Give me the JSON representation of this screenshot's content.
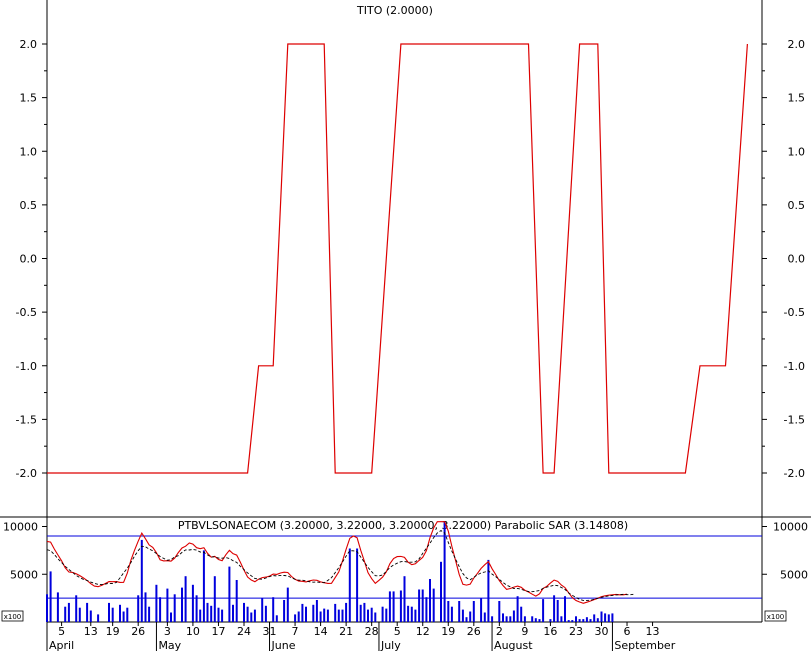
{
  "colors": {
    "tito": "#dd0000",
    "bars": "#0000dd",
    "band": "#0000dd",
    "sar": "#000000",
    "axis": "#000000"
  },
  "chart_data": [
    {
      "type": "line",
      "title": "TITO (2.0000)",
      "ylim": [
        -2.4,
        2.4
      ],
      "yticks": [
        "2.0",
        "1.5",
        "1.0",
        "0.5",
        "0.0",
        "-0.5",
        "-1.0",
        "-1.5",
        "-2.0"
      ],
      "ytick_values": [
        2.0,
        1.5,
        1.0,
        0.5,
        0.0,
        -0.5,
        -1.0,
        -1.5,
        -2.0
      ],
      "grid": false,
      "series": [
        {
          "values_x": [
            1,
            56,
            59,
            63,
            67,
            69,
            77,
            80,
            86,
            88,
            90,
            98,
            133,
            137,
            140,
            147,
            152,
            155,
            176,
            180,
            187,
            193
          ],
          "values_y": [
            -2,
            -2,
            -1,
            -1,
            2,
            2,
            2,
            -2,
            -2,
            -2,
            -2,
            2,
            2,
            -2,
            -2,
            2,
            2,
            -2,
            -2,
            -1,
            -1,
            2
          ]
        }
      ]
    },
    {
      "type": "bar",
      "title": "PTBVLSONAECOM (3.20000, 3.22000, 3.20000, 3.22000) Parabolic SAR (3.14808)",
      "ylim": [
        0,
        11000
      ],
      "yticks": [
        "10000",
        "5000"
      ],
      "ytick_values": [
        10000,
        5000
      ],
      "unit_label": "x100",
      "bands": [
        9000,
        2500
      ],
      "x_tick_labels": [
        "5",
        "13",
        "19",
        "26",
        "3",
        "10",
        "17",
        "24",
        "31",
        "7",
        "14",
        "21",
        "28",
        "5",
        "12",
        "19",
        "26",
        "2",
        "9",
        "16",
        "23",
        "30",
        "6",
        "13"
      ],
      "x_tick_days": [
        5,
        13,
        19,
        26,
        34,
        41,
        48,
        55,
        62,
        69,
        76,
        83,
        90,
        97,
        104,
        111,
        118,
        125,
        132,
        139,
        146,
        153,
        160,
        167
      ],
      "months": [
        "April",
        "May",
        "June",
        "July",
        "August",
        "September"
      ],
      "month_days": [
        1,
        31,
        62,
        92,
        123,
        156
      ],
      "volume_days": [
        1,
        2,
        4,
        6,
        7,
        9,
        10,
        12,
        13,
        15,
        18,
        19,
        21,
        22,
        23,
        26,
        27,
        28,
        29,
        31,
        32,
        34,
        35,
        36,
        38,
        39,
        41,
        42,
        43,
        44,
        45,
        46,
        47,
        48,
        49,
        51,
        52,
        53,
        55,
        56,
        57,
        58,
        60,
        61,
        63,
        64,
        66,
        67,
        69,
        70,
        71,
        72,
        74,
        75,
        76,
        77,
        78,
        80,
        81,
        82,
        83,
        84,
        86,
        87,
        88,
        89,
        90,
        91,
        93,
        94,
        95,
        96,
        98,
        99,
        100,
        101,
        102,
        103,
        104,
        105,
        106,
        107,
        109,
        110,
        111,
        112,
        114,
        115,
        116,
        117,
        118,
        120,
        121,
        122,
        123,
        125,
        126,
        127,
        128,
        129,
        130,
        131,
        132,
        134,
        135,
        136,
        137,
        139,
        140,
        141,
        142,
        143,
        144,
        145,
        146,
        147,
        148,
        149,
        150,
        151,
        152,
        153,
        154,
        155,
        156
      ],
      "volume_values": [
        2900,
        5300,
        3100,
        1600,
        2000,
        2800,
        1500,
        2000,
        1200,
        800,
        2000,
        1500,
        1800,
        1100,
        1500,
        2800,
        8600,
        3100,
        1600,
        3900,
        2600,
        3500,
        1000,
        2900,
        3600,
        4800,
        3900,
        2800,
        1300,
        7500,
        2000,
        1700,
        4800,
        1500,
        1300,
        5800,
        1800,
        4400,
        2000,
        1600,
        1000,
        1300,
        2500,
        1700,
        2600,
        700,
        2300,
        3600,
        800,
        1100,
        1900,
        1600,
        1800,
        2300,
        1100,
        1400,
        1300,
        1900,
        1300,
        1300,
        2000,
        7700,
        7700,
        1800,
        2000,
        1300,
        1500,
        1000,
        1600,
        1400,
        3200,
        3200,
        3300,
        4800,
        1700,
        1600,
        1300,
        3400,
        3400,
        2600,
        4500,
        3500,
        6300,
        10500,
        2200,
        1600,
        2200,
        1300,
        500,
        1100,
        2200,
        2500,
        1000,
        6500,
        600,
        2200,
        900,
        600,
        600,
        1200,
        2700,
        1600,
        600,
        600,
        400,
        300,
        2400,
        300,
        2800,
        2300,
        600,
        2700,
        200,
        200,
        600,
        300,
        300,
        500,
        300,
        800,
        400,
        1100,
        900,
        800,
        900,
        300,
        200
      ]
    }
  ]
}
